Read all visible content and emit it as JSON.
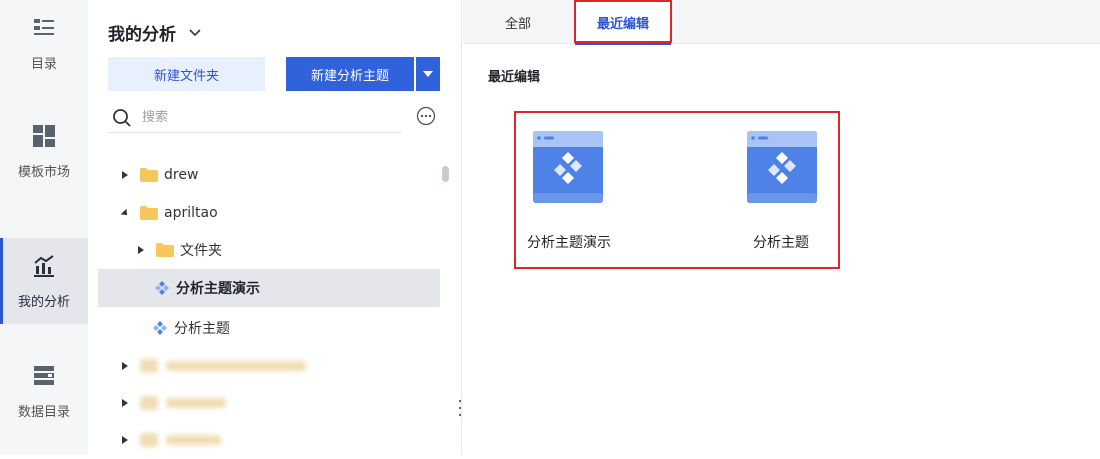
{
  "rail": {
    "items": [
      {
        "label": "目录",
        "icon": "directory-icon",
        "active": false
      },
      {
        "label": "模板市场",
        "icon": "template-market-icon",
        "active": false
      },
      {
        "label": "我的分析",
        "icon": "my-analysis-icon",
        "active": true
      },
      {
        "label": "数据目录",
        "icon": "data-catalog-icon",
        "active": false
      }
    ]
  },
  "panel": {
    "title": "我的分析",
    "new_folder_label": "新建文件夹",
    "new_theme_label": "新建分析主题",
    "search_placeholder": "搜索",
    "tree": [
      {
        "label": "drew",
        "type": "folder",
        "expanded": false
      },
      {
        "label": "apriltao",
        "type": "folder",
        "expanded": true
      },
      {
        "label": "文件夹",
        "type": "folder",
        "expanded": false
      },
      {
        "label": "分析主题演示",
        "type": "theme",
        "selected": true
      },
      {
        "label": "分析主题",
        "type": "theme",
        "selected": false
      }
    ]
  },
  "main": {
    "tabs": [
      {
        "label": "全部",
        "active": false
      },
      {
        "label": "最近编辑",
        "active": true
      }
    ],
    "section_title": "最近编辑",
    "cards": [
      {
        "label": "分析主题演示",
        "icon": "analysis-theme-thumbnail-icon"
      },
      {
        "label": "分析主题",
        "icon": "analysis-theme-thumbnail-icon"
      }
    ]
  },
  "colors": {
    "accent": "#2f62db",
    "highlight_border": "#e2252c",
    "folder": "#f7c65c",
    "rail_bg": "#f5f6f8"
  }
}
